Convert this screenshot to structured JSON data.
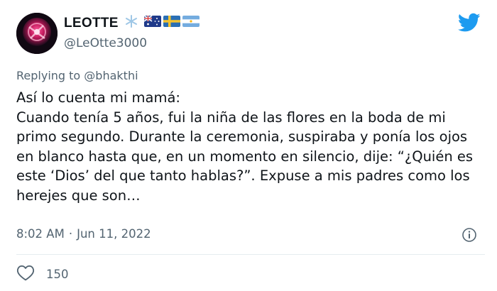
{
  "author": {
    "name": "LEOTTE",
    "handle": "@LeOtte3000",
    "flags": [
      "snowflake-icon",
      "australia-flag-icon",
      "sweden-flag-icon",
      "argentina-flag-icon"
    ]
  },
  "reply": {
    "prefix": "Replying to",
    "target": "@bhakthi"
  },
  "tweet": {
    "text": "Así lo cuenta mi mamá:\nCuando tenía 5 años, fui la niña de las flores en la boda de mi primo segundo. Durante la ceremonia, suspiraba y ponía los ojos en blanco hasta que, en un momento en silencio, dije: “¿Quién es este ‘Dios’ del que tanto hablas?”. Expuse a mis padres como los herejes que son…",
    "time": "8:02 AM",
    "separator": "·",
    "date": "Jun 11, 2022"
  },
  "engagement": {
    "like_count": "150"
  },
  "colors": {
    "twitter_blue": "#1d9bf0",
    "muted": "#536471",
    "text": "#0f1419"
  }
}
